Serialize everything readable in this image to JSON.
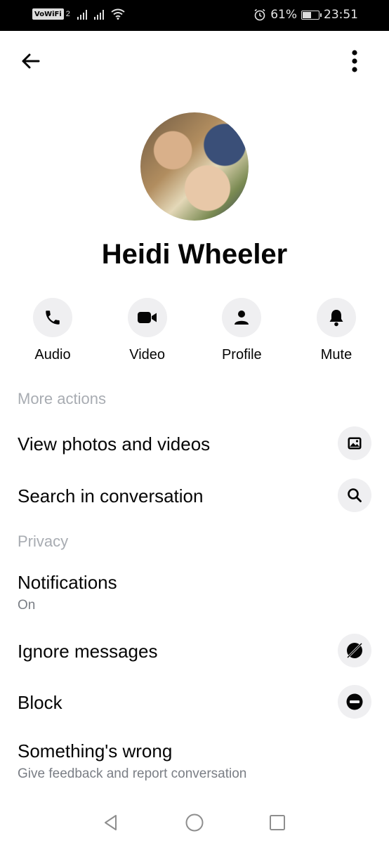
{
  "status_bar": {
    "carrier_badge": "VoWiFi",
    "carrier_badge_num": "2",
    "battery_percent": "61%",
    "battery_level": 0.61,
    "time": "23:51",
    "icons": [
      "signal-icon",
      "signal-icon",
      "wifi-icon",
      "alarm-icon",
      "battery-icon"
    ]
  },
  "header": {
    "back_icon": "arrow-left-icon",
    "menu_icon": "more-vertical-icon"
  },
  "profile": {
    "name": "Heidi Wheeler"
  },
  "quick_actions": [
    {
      "label": "Audio",
      "icon": "phone-icon"
    },
    {
      "label": "Video",
      "icon": "video-camera-icon"
    },
    {
      "label": "Profile",
      "icon": "person-icon"
    },
    {
      "label": "Mute",
      "icon": "bell-icon"
    }
  ],
  "sections": {
    "more_actions": "More actions",
    "privacy": "Privacy"
  },
  "rows": {
    "view_photos": {
      "title": "View photos and videos",
      "icon": "image-icon"
    },
    "search": {
      "title": "Search in conversation",
      "icon": "search-icon"
    },
    "notifications": {
      "title": "Notifications",
      "subtitle": "On"
    },
    "ignore": {
      "title": "Ignore messages",
      "icon": "ignore-icon"
    },
    "block": {
      "title": "Block",
      "icon": "block-icon"
    },
    "something_wrong": {
      "title": "Something's wrong",
      "subtitle": "Give feedback and report conversation"
    }
  },
  "nav_bar": {
    "icons": [
      "back-triangle-icon",
      "home-circle-icon",
      "recents-square-icon"
    ]
  },
  "colors": {
    "text": "#050505",
    "secondary_text": "#7a7e85",
    "section_text": "#a8acb2",
    "icon_bg": "#efeff1"
  }
}
